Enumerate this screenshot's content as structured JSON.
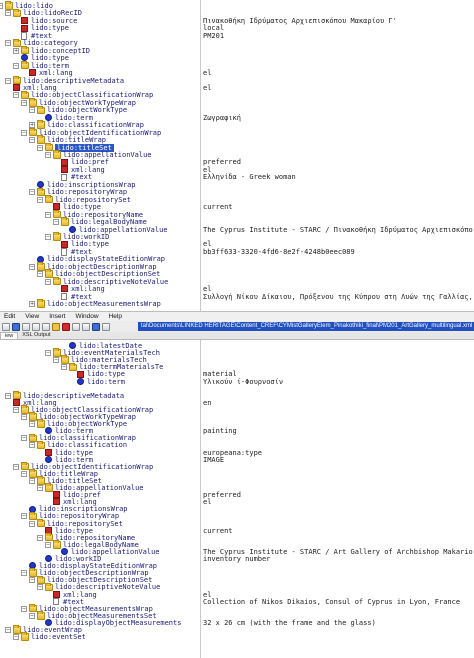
{
  "menu": {
    "edit": "Edit",
    "view": "View",
    "insert": "Insert",
    "window": "Window",
    "help": "Help"
  },
  "path": "tal\\Documents\\LINKED HERITAGE\\Content_CREF\\CYMistGalleryElem_Pinakothiki_final\\PM201_ArtGallery_multilingual.xml",
  "tabs": {
    "view": "iew",
    "xsl": "XSL Output"
  },
  "icons": {
    "folder": "folder-icon",
    "element": "element-icon",
    "attribute": "attribute-icon",
    "text": "text-node-icon",
    "save": "save-icon",
    "open": "open-icon",
    "cut": "cut-icon",
    "copy": "copy-icon",
    "paste": "paste-icon",
    "delete": "delete-icon"
  },
  "pane1": [
    {
      "d": 0,
      "i": "folder",
      "n": "lido:lido",
      "v": "",
      "t": "-"
    },
    {
      "d": 1,
      "i": "folder",
      "n": "lido:lidoRecID",
      "v": "",
      "t": "-"
    },
    {
      "d": 2,
      "i": "attr",
      "n": "lido:source",
      "v": "Πινακοθήκη Ιδρύματος Αρχιεπισκόπου Μακαρίου Γ'"
    },
    {
      "d": 2,
      "i": "attr",
      "n": "lido:type",
      "v": "local"
    },
    {
      "d": 2,
      "i": "text",
      "n": "#text",
      "v": "PM201"
    },
    {
      "d": 1,
      "i": "folder",
      "n": "lido:category",
      "v": "",
      "t": "-"
    },
    {
      "d": 2,
      "i": "folder",
      "n": "lido:conceptID",
      "v": "",
      "t": "+"
    },
    {
      "d": 2,
      "i": "elem",
      "n": "lido:type",
      "v": ""
    },
    {
      "d": 2,
      "i": "folder",
      "n": "lido:term",
      "v": "",
      "t": "-"
    },
    {
      "d": 3,
      "i": "attr",
      "n": "xml:lang",
      "v": "el"
    },
    {
      "d": 1,
      "i": "folder",
      "n": "lido:descriptiveMetadata",
      "v": "",
      "t": "-"
    },
    {
      "d": 1,
      "i": "attr",
      "n": "xml:lang",
      "v": "el"
    },
    {
      "d": 2,
      "i": "folder",
      "n": "lido:objectClassificationWrap",
      "v": "",
      "t": "-"
    },
    {
      "d": 3,
      "i": "folder",
      "n": "lido:objectWorkTypeWrap",
      "v": "",
      "t": "-"
    },
    {
      "d": 4,
      "i": "folder",
      "n": "lido:objectWorkType",
      "v": "",
      "t": "-"
    },
    {
      "d": 5,
      "i": "elem",
      "n": "lido:term",
      "v": "Ζωγραφική"
    },
    {
      "d": 4,
      "i": "folder",
      "n": "lido:classificationWrap",
      "v": "",
      "t": "+"
    },
    {
      "d": 3,
      "i": "folder",
      "n": "lido:objectIdentificationWrap",
      "v": "",
      "t": "-"
    },
    {
      "d": 4,
      "i": "folder",
      "n": "lido:titleWrap",
      "v": "",
      "t": "-"
    },
    {
      "d": 5,
      "i": "folder",
      "n": "lido:titleSet",
      "v": "",
      "t": "-",
      "sel": true
    },
    {
      "d": 6,
      "i": "folder",
      "n": "lido:appellationValue",
      "v": "",
      "t": "-"
    },
    {
      "d": 7,
      "i": "attr",
      "n": "lido:pref",
      "v": "preferred"
    },
    {
      "d": 7,
      "i": "attr",
      "n": "xml:lang",
      "v": "el"
    },
    {
      "d": 7,
      "i": "text",
      "n": "#text",
      "v": "Ελληνίδα - Greek woman"
    },
    {
      "d": 4,
      "i": "elem",
      "n": "lido:inscriptionsWrap",
      "v": ""
    },
    {
      "d": 4,
      "i": "folder",
      "n": "lido:repositoryWrap",
      "v": "",
      "t": "-"
    },
    {
      "d": 5,
      "i": "folder",
      "n": "lido:repositorySet",
      "v": "",
      "t": "-"
    },
    {
      "d": 6,
      "i": "attr",
      "n": "lido:type",
      "v": "current"
    },
    {
      "d": 6,
      "i": "folder",
      "n": "lido:repositoryName",
      "v": "",
      "t": "-"
    },
    {
      "d": 7,
      "i": "folder",
      "n": "lido:legalBodyName",
      "v": "",
      "t": "-"
    },
    {
      "d": 8,
      "i": "elem",
      "n": "lido:appellationValue",
      "v": "The Cyprus Institute - STARC / Πινακοθήκη Ιδρύματος Αρχιεπισκόπου"
    },
    {
      "d": 6,
      "i": "folder",
      "n": "lido:workID",
      "v": "",
      "t": "-"
    },
    {
      "d": 7,
      "i": "attr",
      "n": "lido:type",
      "v": "el"
    },
    {
      "d": 7,
      "i": "text",
      "n": "#text",
      "v": "bb3ff633-3320-4fd6-8e2f-4248b0eec089"
    },
    {
      "d": 4,
      "i": "elem",
      "n": "lido:displayStateEditionWrap",
      "v": ""
    },
    {
      "d": 4,
      "i": "folder",
      "n": "lido:objectDescriptionWrap",
      "v": "",
      "t": "-"
    },
    {
      "d": 5,
      "i": "folder",
      "n": "lido:objectDescriptionSet",
      "v": "",
      "t": "-"
    },
    {
      "d": 6,
      "i": "folder",
      "n": "lido:descriptiveNoteValue",
      "v": "",
      "t": "-"
    },
    {
      "d": 7,
      "i": "attr",
      "n": "xml:lang",
      "v": "el"
    },
    {
      "d": 7,
      "i": "text",
      "n": "#text",
      "v": "Συλλογή Νίκου Δίκαιου, Πρόξενου της Κύπρου στη Λυών της Γαλλίας,"
    },
    {
      "d": 4,
      "i": "folder",
      "n": "lido:objectMeasurementsWrap",
      "v": "",
      "t": "+"
    }
  ],
  "pane2": [
    {
      "d": 8,
      "i": "elem",
      "n": "lido:latestDate",
      "v": ""
    },
    {
      "d": 6,
      "i": "folder",
      "n": "lido:eventMaterialsTech",
      "v": "",
      "t": "-"
    },
    {
      "d": 7,
      "i": "folder",
      "n": "lido:materialsTech",
      "v": "",
      "t": "-"
    },
    {
      "d": 8,
      "i": "folder",
      "n": "lido:termMaterialsTe",
      "v": "",
      "t": "-"
    },
    {
      "d": 9,
      "i": "attr",
      "n": "lido:type",
      "v": "material"
    },
    {
      "d": 9,
      "i": "elem",
      "n": "lido:term",
      "v": "Υλικούν ί-Φουρνοσίν"
    },
    {
      "d": 0,
      "i": "blank",
      "n": "",
      "v": ""
    },
    {
      "d": 1,
      "i": "folder",
      "n": "lido:descriptiveMetadata",
      "v": "",
      "t": "-"
    },
    {
      "d": 1,
      "i": "attr",
      "n": "xml:lang",
      "v": "en"
    },
    {
      "d": 2,
      "i": "folder",
      "n": "lido:objectClassificationWrap",
      "v": "",
      "t": "-"
    },
    {
      "d": 3,
      "i": "folder",
      "n": "lido:objectWorkTypeWrap",
      "v": "",
      "t": "-"
    },
    {
      "d": 4,
      "i": "folder",
      "n": "lido:objectWorkType",
      "v": "",
      "t": "-"
    },
    {
      "d": 5,
      "i": "elem",
      "n": "lido:term",
      "v": "painting"
    },
    {
      "d": 3,
      "i": "folder",
      "n": "lido:classificationWrap",
      "v": "",
      "t": "-"
    },
    {
      "d": 4,
      "i": "folder",
      "n": "lido:classification",
      "v": "",
      "t": "-"
    },
    {
      "d": 5,
      "i": "attr",
      "n": "lido:type",
      "v": "europeana:type"
    },
    {
      "d": 5,
      "i": "elem",
      "n": "lido:term",
      "v": "IMAGE"
    },
    {
      "d": 2,
      "i": "folder",
      "n": "lido:objectIdentificationWrap",
      "v": "",
      "t": "-"
    },
    {
      "d": 3,
      "i": "folder",
      "n": "lido:titleWrap",
      "v": "",
      "t": "-"
    },
    {
      "d": 4,
      "i": "folder",
      "n": "lido:titleSet",
      "v": "",
      "t": "-"
    },
    {
      "d": 5,
      "i": "folder",
      "n": "lido:appellationValue",
      "v": "",
      "t": "-"
    },
    {
      "d": 6,
      "i": "attr",
      "n": "lido:pref",
      "v": "preferred"
    },
    {
      "d": 6,
      "i": "attr",
      "n": "xml:lang",
      "v": "el"
    },
    {
      "d": 3,
      "i": "elem",
      "n": "lido:inscriptionsWrap",
      "v": ""
    },
    {
      "d": 3,
      "i": "folder",
      "n": "lido:repositoryWrap",
      "v": "",
      "t": "-"
    },
    {
      "d": 4,
      "i": "folder",
      "n": "lido:repositorySet",
      "v": "",
      "t": "-"
    },
    {
      "d": 5,
      "i": "attr",
      "n": "lido:type",
      "v": "current"
    },
    {
      "d": 5,
      "i": "folder",
      "n": "lido:repositoryName",
      "v": "",
      "t": "-"
    },
    {
      "d": 6,
      "i": "folder",
      "n": "lido:legalBodyName",
      "v": "",
      "t": "-"
    },
    {
      "d": 7,
      "i": "elem",
      "n": "lido:appellationValue",
      "v": "The Cyprus Institute - STARC / Art Gallery of Archbishop Makarios"
    },
    {
      "d": 5,
      "i": "elem",
      "n": "lido:workID",
      "v": "inventory number"
    },
    {
      "d": 3,
      "i": "elem",
      "n": "lido:displayStateEditionWrap",
      "v": ""
    },
    {
      "d": 3,
      "i": "folder",
      "n": "lido:objectDescriptionWrap",
      "v": "",
      "t": "-"
    },
    {
      "d": 4,
      "i": "folder",
      "n": "lido:objectDescriptionSet",
      "v": "",
      "t": "-"
    },
    {
      "d": 5,
      "i": "folder",
      "n": "lido:descriptiveNoteValue",
      "v": "",
      "t": "-"
    },
    {
      "d": 6,
      "i": "attr",
      "n": "xml:lang",
      "v": "el"
    },
    {
      "d": 6,
      "i": "text",
      "n": "#text",
      "v": "Collection of Nikos Dikaios, Consul of Cyprus in Lyon, France"
    },
    {
      "d": 3,
      "i": "folder",
      "n": "lido:objectMeasurementsWrap",
      "v": "",
      "t": "-"
    },
    {
      "d": 4,
      "i": "folder",
      "n": "lido:objectMeasurementsSet",
      "v": "",
      "t": "-"
    },
    {
      "d": 5,
      "i": "elem",
      "n": "lido:displayObjectMeasurements",
      "v": "32 x 26 cm (with the frame and the glass)"
    },
    {
      "d": 1,
      "i": "folder",
      "n": "lido:eventWrap",
      "v": "",
      "t": "-"
    },
    {
      "d": 2,
      "i": "folder",
      "n": "lido:eventSet",
      "v": "",
      "t": "-"
    }
  ]
}
